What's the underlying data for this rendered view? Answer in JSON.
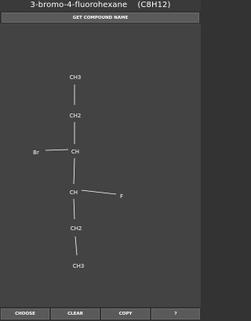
{
  "title": {
    "name": "3-bromo-4-fluorohexane",
    "formula": "(C8H12)"
  },
  "top_button_label": "GET COMPOUND NAME",
  "atoms": {
    "ch3_top": "CH3",
    "ch2_upper": "CH2",
    "br": "Br",
    "ch_upper": "CH",
    "ch_lower": "CH",
    "f": "F",
    "ch2_lower": "CH2",
    "ch3_bottom": "CH3"
  },
  "bottom_buttons": {
    "choose": "CHOOSE",
    "clear": "CLEAR",
    "copy": "COPY",
    "help": "?"
  }
}
